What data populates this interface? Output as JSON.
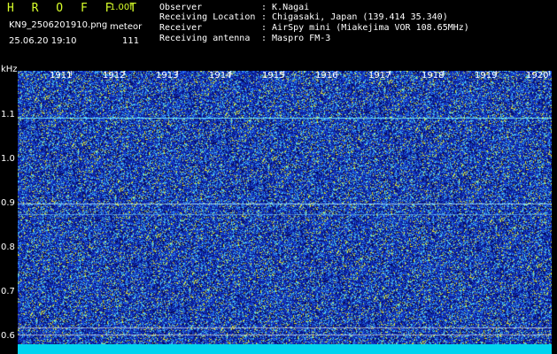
{
  "header": {
    "app_name": "H R O F F T",
    "version": "1.00f",
    "filename": "KN9_2506201910.png",
    "mode": "meteor",
    "datetime": "25.06.20 19:10",
    "count": "111"
  },
  "station": {
    "observer_label": "Observer",
    "observer_value": ": K.Nagai",
    "location_label": "Receiving Location",
    "location_value": ": Chigasaki, Japan (139.414 35.340)",
    "receiver_label": "Receiver",
    "receiver_value": ": AirSpy mini (Miakejima VOR 108.65MHz)",
    "antenna_label": "Receiving antenna",
    "antenna_value": ": Maspro FM-3"
  },
  "axis": {
    "unit": "kHz",
    "y_ticks": [
      "1.1",
      "1.0",
      "0.9",
      "0.8",
      "0.7",
      "0.6"
    ],
    "time_ticks": [
      "1911",
      "1912",
      "1913",
      "1914",
      "1915",
      "1916",
      "1917",
      "1918",
      "1919",
      "1920"
    ]
  },
  "colors": {
    "background": "#000000",
    "spectrogram_base": "#1a2fc4",
    "signal": "#6fe8ff",
    "app_title": "#d8ff2a",
    "bottom_bar": "#00d4f0"
  }
}
